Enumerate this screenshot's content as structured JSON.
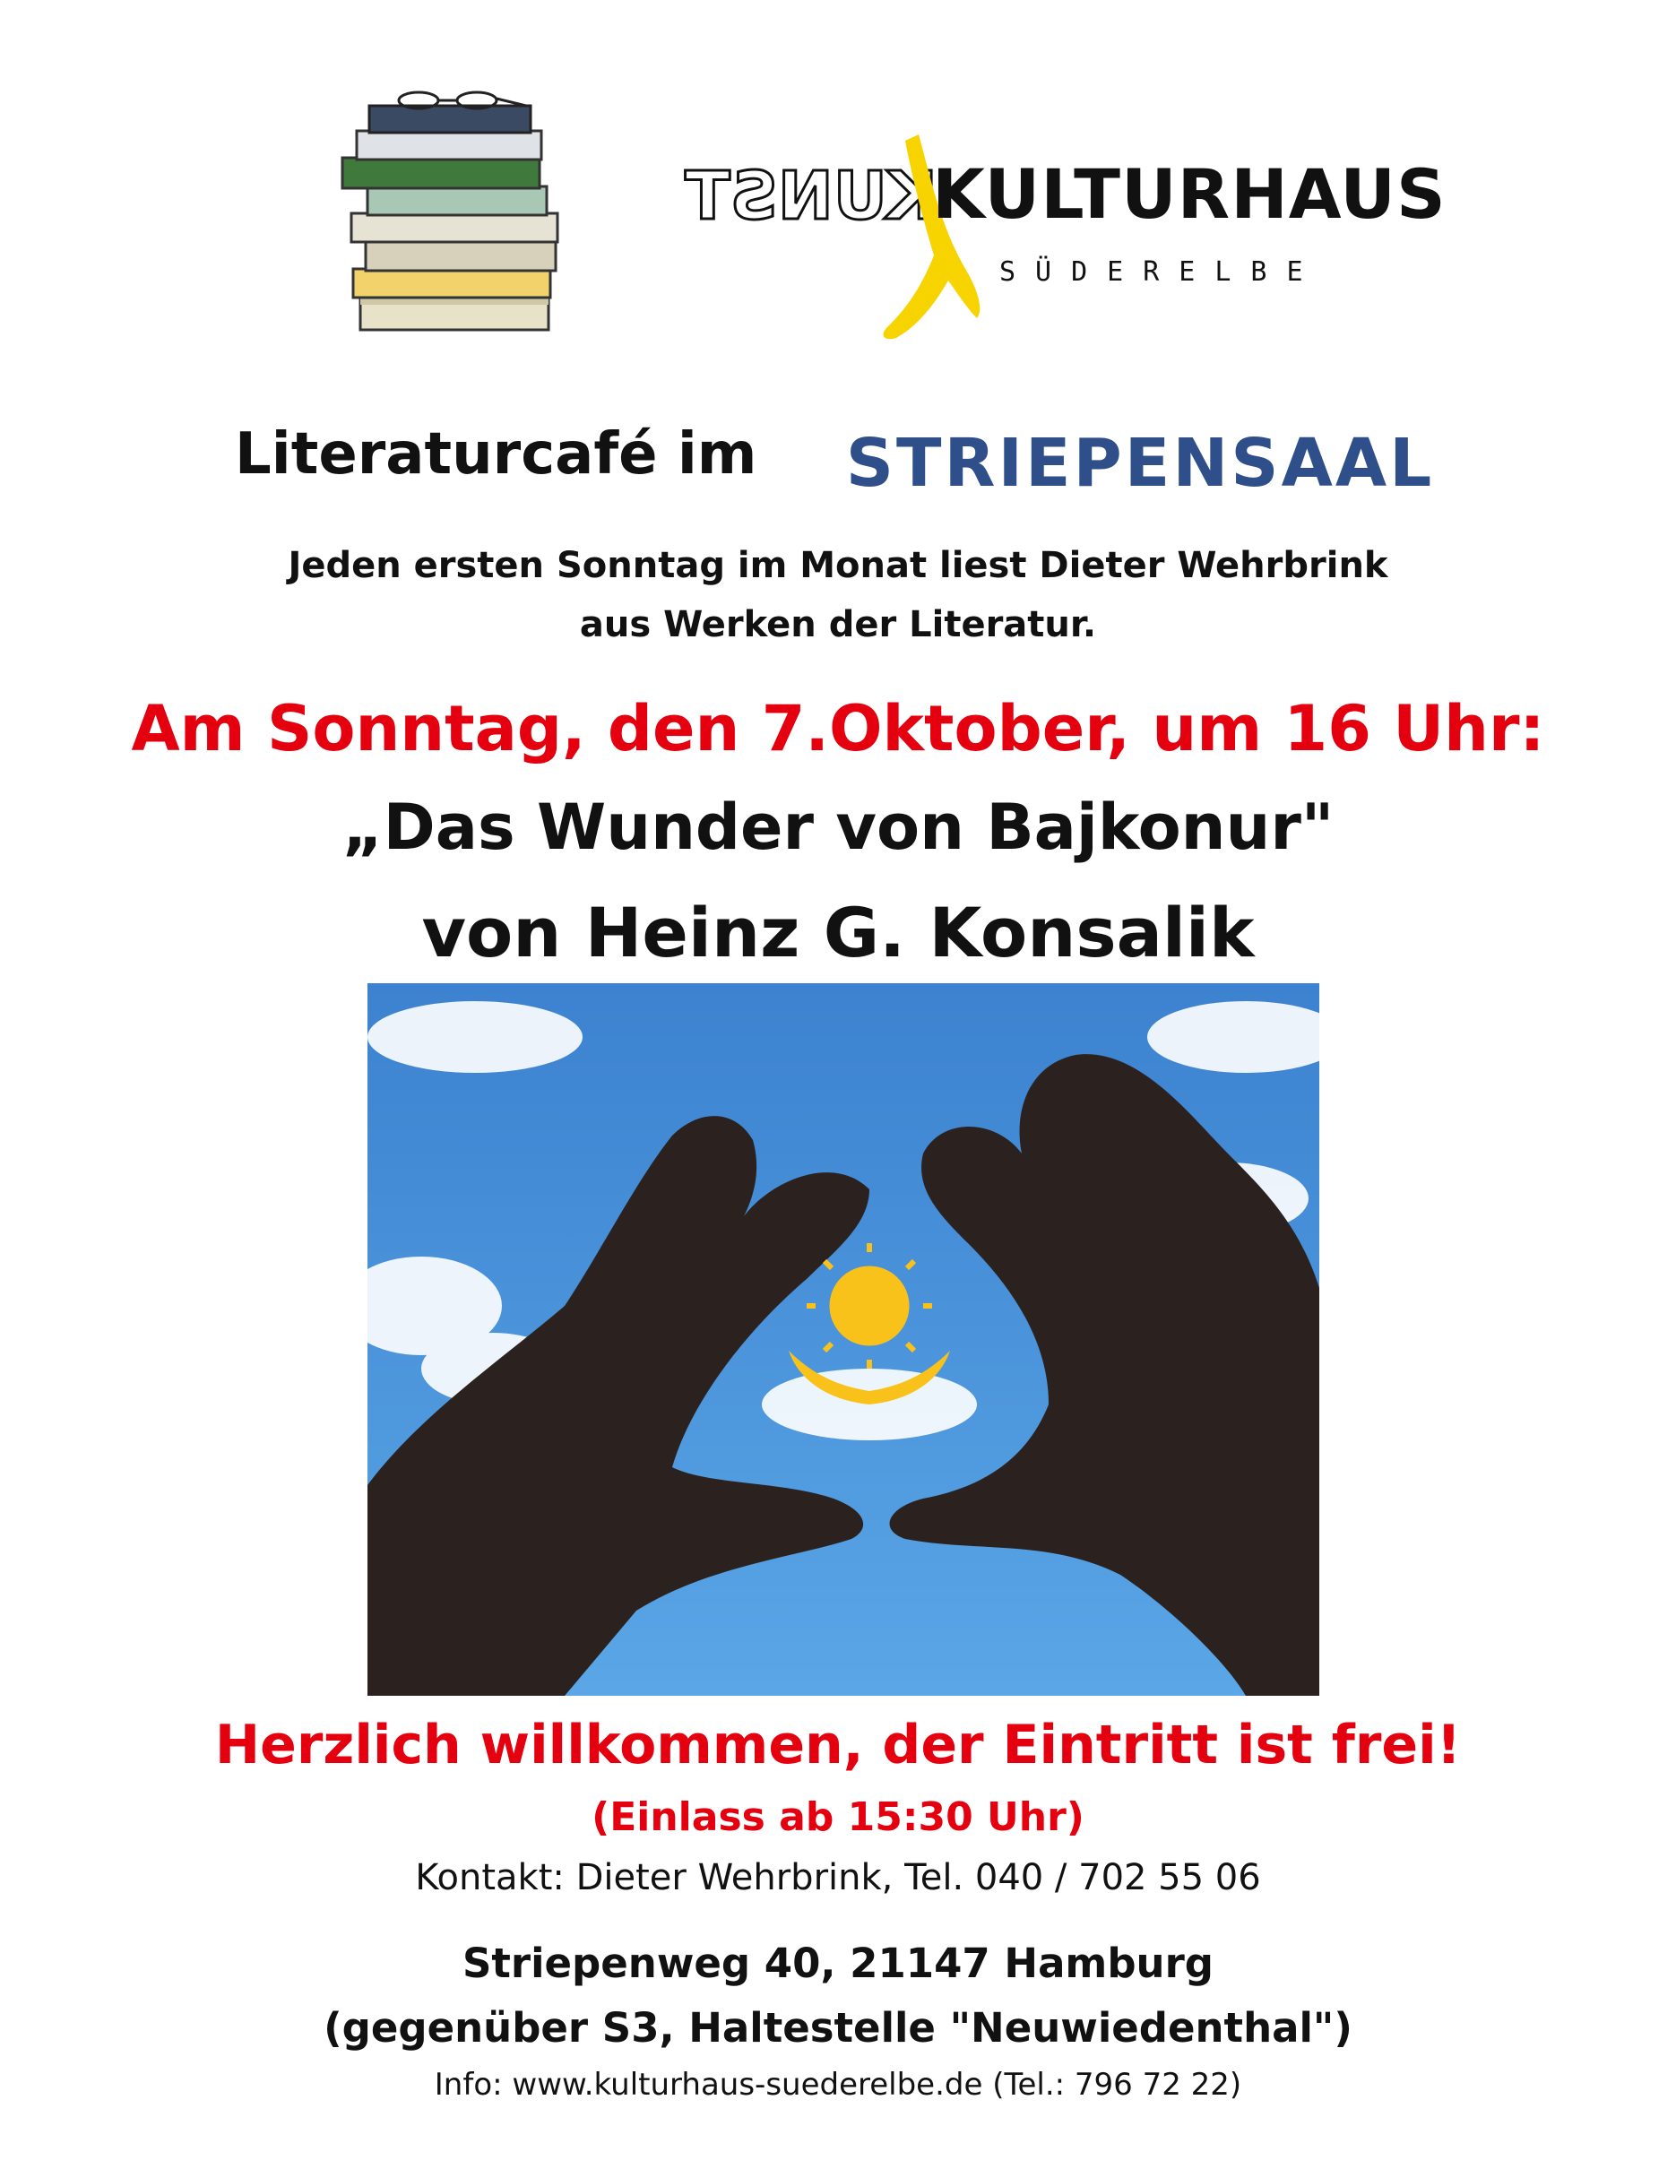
{
  "header": {
    "logo_mirrored": "KUNST",
    "logo_main": "KULTURHAUS",
    "logo_sub": "SÜDERELBE",
    "logo_color": "#f7d300"
  },
  "title": {
    "prefix": "Literaturcafé im",
    "venue": "STRIEPENSAAL"
  },
  "intro": {
    "line1": "Jeden ersten Sonntag im Monat liest Dieter Wehrbrink",
    "line2": "aus Werken der Literatur."
  },
  "event": {
    "date_line": "Am Sonntag, den 7.Oktober, um 16 Uhr:",
    "book_title": "„Das Wunder von Bajkonur\"",
    "author": "von Heinz G. Konsalik"
  },
  "footer": {
    "welcome": "Herzlich willkommen, der Eintritt ist frei!",
    "einlass": "(Einlass ab 15:30 Uhr)",
    "contact": "Kontakt: Dieter Wehrbrink, Tel. 040 / 702 55 06",
    "address": "Striepenweg 40, 21147 Hamburg",
    "stop": "(gegenüber S3, Haltestelle \"Neuwiedenthal\")",
    "info": "Info:  www.kulturhaus-suederelbe.de  (Tel.: 796 72 22)"
  },
  "colors": {
    "accent_red": "#e4000f",
    "sky": "#4a8fd6",
    "sun": "#f9c21b"
  }
}
